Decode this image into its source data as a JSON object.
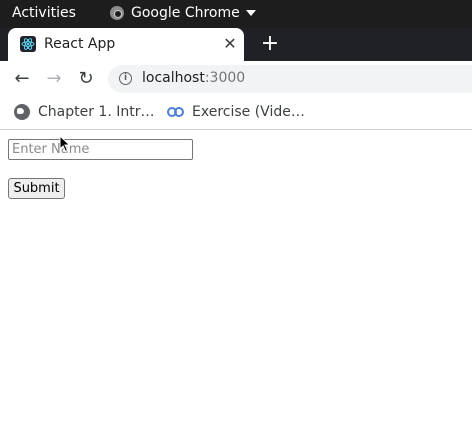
{
  "topbar": {
    "activities_label": "Activities",
    "app_name": "Google Chrome"
  },
  "tabs": [
    {
      "title": "React App",
      "icon": "react-favicon"
    }
  ],
  "toolbar": {
    "url_host": "localhost",
    "url_port": ":3000"
  },
  "bookmarks": [
    {
      "label": "Chapter 1. Intr…",
      "icon": "globe-icon"
    },
    {
      "label": "Exercise (Vide…",
      "icon": "link-icon"
    }
  ],
  "form": {
    "name_placeholder": "Enter Name",
    "name_value": "",
    "submit_label": "Submit"
  },
  "colors": {
    "topbar_bg": "#1d1d1d",
    "tabstrip_bg": "#202124",
    "link_accent": "#4a7fd6"
  }
}
